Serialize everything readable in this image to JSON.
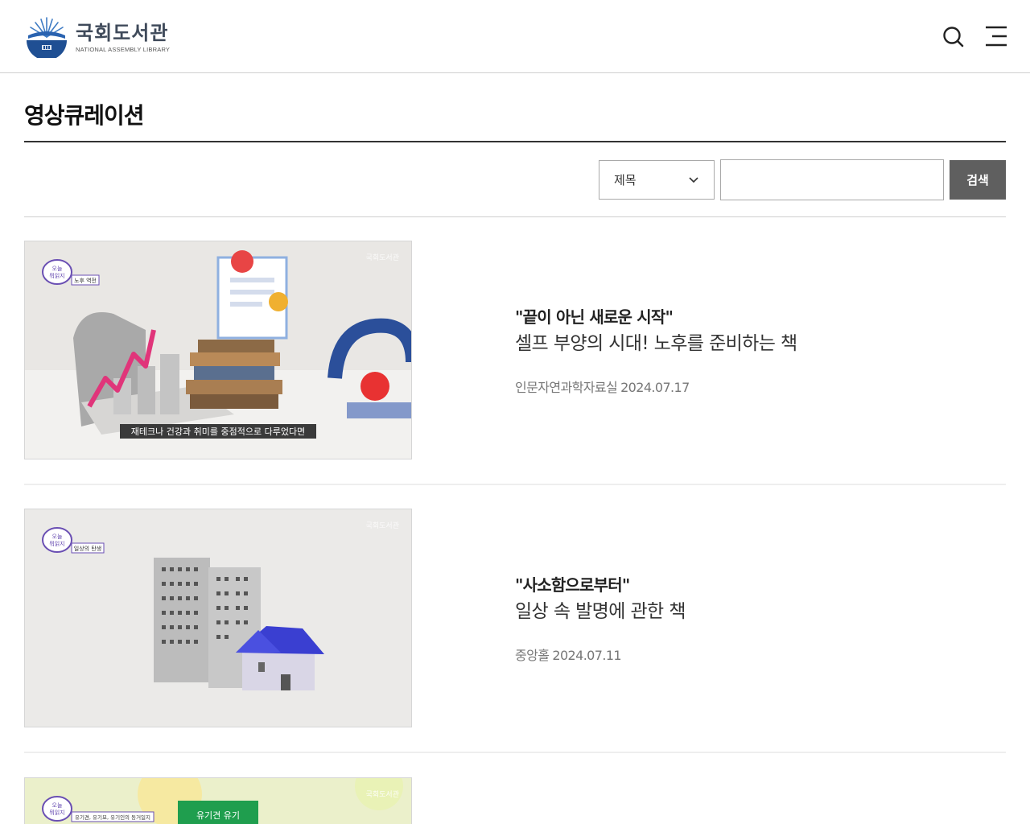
{
  "header": {
    "logo_ko": "국회도서관",
    "logo_en": "NATIONAL ASSEMBLY LIBRARY",
    "search_icon": "search-icon",
    "menu_icon": "hamburger-menu-icon"
  },
  "page": {
    "title": "영상큐레이션"
  },
  "search": {
    "field_selected": "제목",
    "input_value": "",
    "button_label": "검색"
  },
  "items": [
    {
      "quote": "\"끝이 아닌 새로운 시작\"",
      "subtitle": "셀프 부양의 시대! 노후를 준비하는 책",
      "location": "인문자연과학자료실",
      "date": "2024.07.17",
      "thumb": {
        "corner_label": "노후 역전",
        "watermark": "국회도서관",
        "caption": "재테크나 건강과 취미를 중점적으로 다루었다면"
      }
    },
    {
      "quote": "\"사소함으로부터\"",
      "subtitle": "일상 속 발명에 관한 책",
      "location": "중앙홀",
      "date": "2024.07.11",
      "thumb": {
        "corner_label": "일상의 탄생",
        "watermark": "국회도서관",
        "caption": ""
      }
    },
    {
      "quote": "",
      "subtitle": "",
      "location": "",
      "date": "",
      "thumb": {
        "corner_label": "유기견, 유기묘, 유기인의 동거일지",
        "watermark": "국회도서관",
        "caption": ""
      }
    }
  ],
  "colors": {
    "button_bg": "#5f5f5f",
    "logo_blue": "#1f4f93",
    "title_rule": "#333333"
  }
}
